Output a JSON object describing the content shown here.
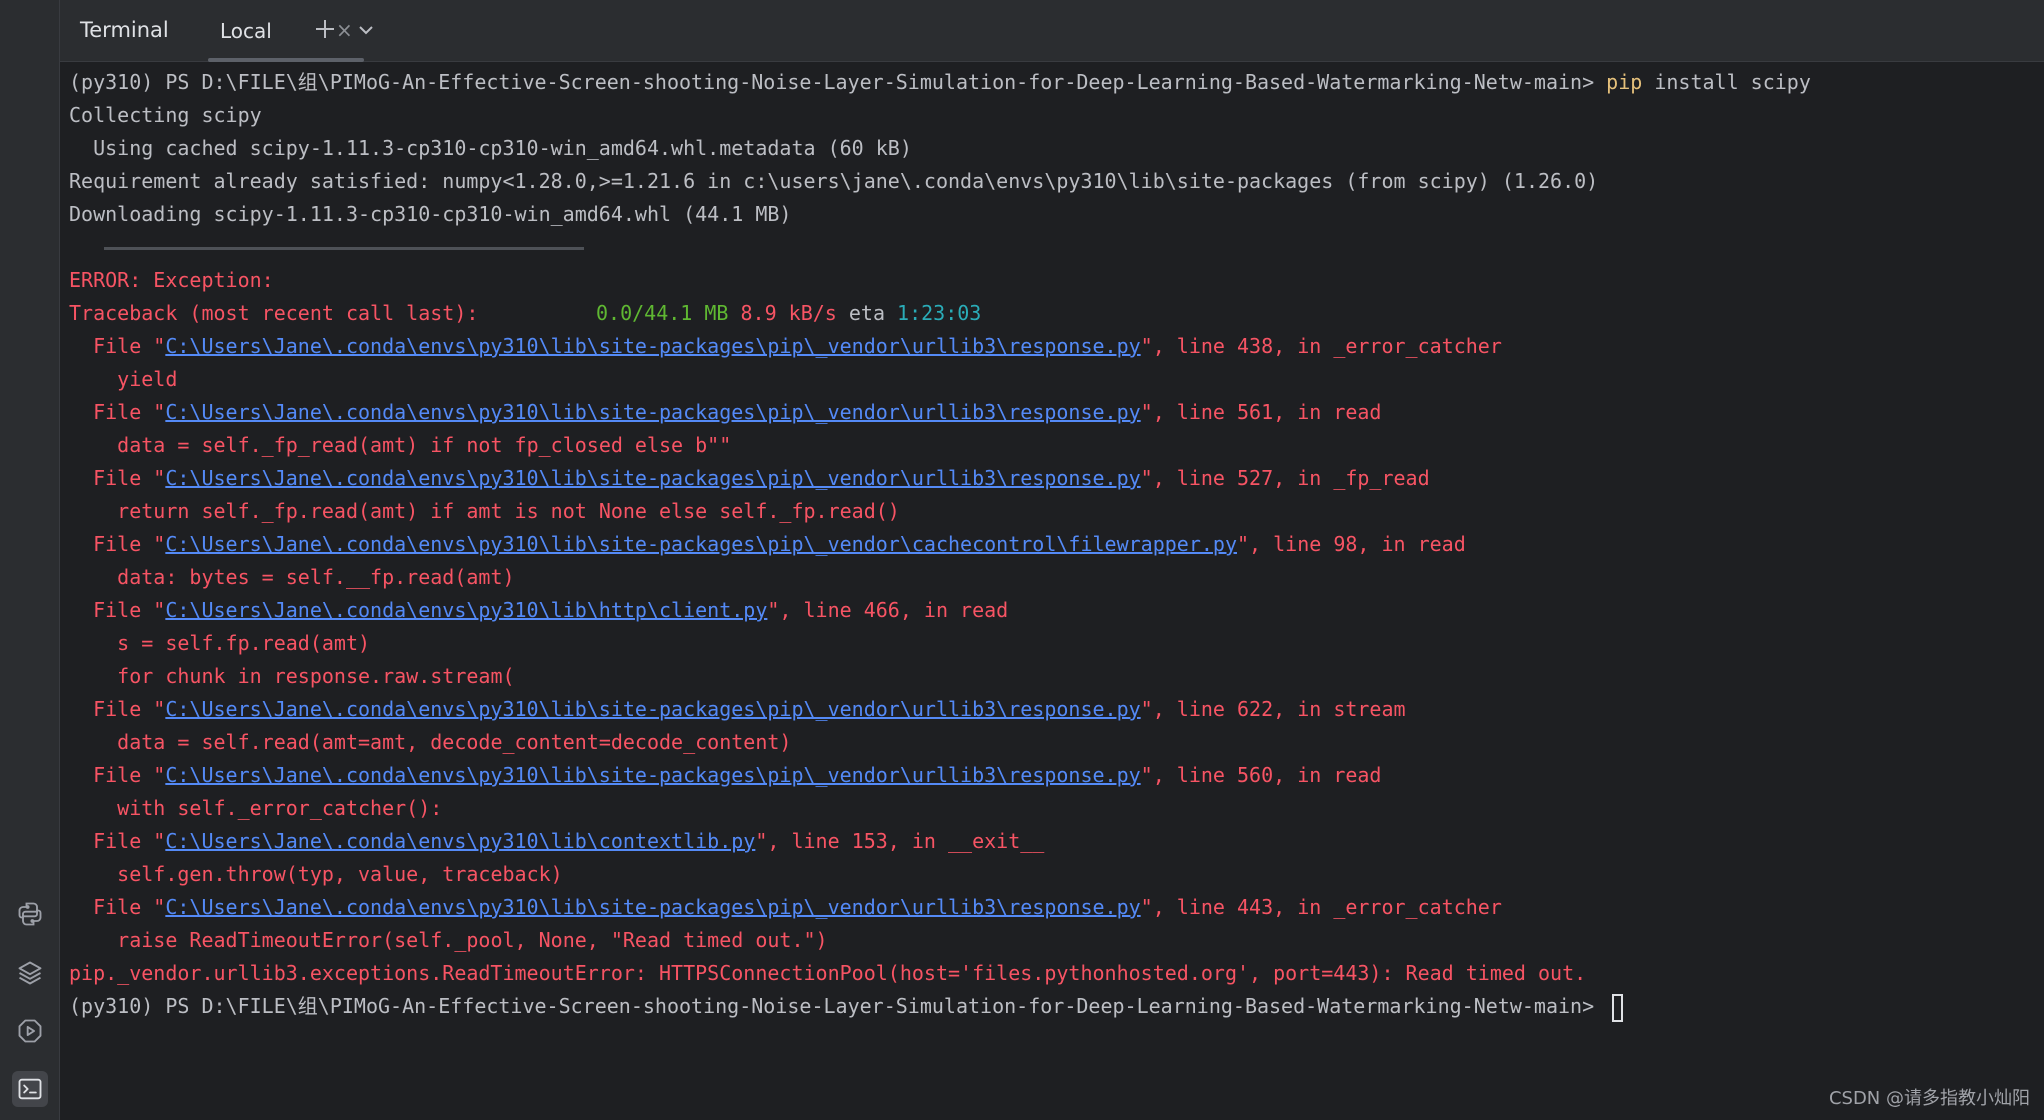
{
  "window": {
    "tool_title": "Terminal",
    "tab": {
      "label": "Local",
      "close_glyph": "×"
    }
  },
  "sidebar": {
    "icons": [
      "python-console-icon",
      "layers-icon",
      "run-services-icon",
      "terminal-icon"
    ]
  },
  "terminal": {
    "prompt1": {
      "prefix": "(py310) PS D:\\FILE\\组\\PIMoG-An-Effective-Screen-shooting-Noise-Layer-Simulation-for-Deep-Learning-Based-Watermarking-Netw-main> ",
      "cmd": "pip",
      "args": " install scipy"
    },
    "l_collecting": "Collecting scipy",
    "l_cached": "  Using cached scipy-1.11.3-cp310-cp310-win_amd64.whl.metadata (60 kB)",
    "l_requirement": "Requirement already satisfied: numpy<1.28.0,>=1.21.6 in c:\\users\\jane\\.conda\\envs\\py310\\lib\\site-packages (from scipy) (1.26.0)",
    "l_downloading": "Downloading scipy-1.11.3-cp310-cp310-win_amd64.whl (44.1 MB)",
    "progress": {
      "fraction": 0.0,
      "size": "0.0/44.1 MB",
      "speed": "8.9 kB/s",
      "eta_label": "eta",
      "eta": "1:23:03"
    },
    "l_error": "ERROR: Exception:",
    "l_traceback": "Traceback (most recent call last):",
    "frames": [
      {
        "path": "C:\\Users\\Jane\\.conda\\envs\\py310\\lib\\site-packages\\pip\\_vendor\\urllib3\\response.py",
        "where": "\", line 438, in _error_catcher",
        "code": [
          "yield"
        ]
      },
      {
        "path": "C:\\Users\\Jane\\.conda\\envs\\py310\\lib\\site-packages\\pip\\_vendor\\urllib3\\response.py",
        "where": "\", line 561, in read",
        "code": [
          "data = self._fp_read(amt) if not fp_closed else b\"\""
        ]
      },
      {
        "path": "C:\\Users\\Jane\\.conda\\envs\\py310\\lib\\site-packages\\pip\\_vendor\\urllib3\\response.py",
        "where": "\", line 527, in _fp_read",
        "code": [
          "return self._fp.read(amt) if amt is not None else self._fp.read()"
        ]
      },
      {
        "path": "C:\\Users\\Jane\\.conda\\envs\\py310\\lib\\site-packages\\pip\\_vendor\\cachecontrol\\filewrapper.py",
        "where": "\", line 98, in read",
        "code": [
          "data: bytes = self.__fp.read(amt)"
        ]
      },
      {
        "path": "C:\\Users\\Jane\\.conda\\envs\\py310\\lib\\http\\client.py",
        "where": "\", line 466, in read",
        "code": [
          "s = self.fp.read(amt)",
          "for chunk in response.raw.stream("
        ]
      },
      {
        "path": "C:\\Users\\Jane\\.conda\\envs\\py310\\lib\\site-packages\\pip\\_vendor\\urllib3\\response.py",
        "where": "\", line 622, in stream",
        "code": [
          "data = self.read(amt=amt, decode_content=decode_content)"
        ]
      },
      {
        "path": "C:\\Users\\Jane\\.conda\\envs\\py310\\lib\\site-packages\\pip\\_vendor\\urllib3\\response.py",
        "where": "\", line 560, in read",
        "code": [
          "with self._error_catcher():"
        ]
      },
      {
        "path": "C:\\Users\\Jane\\.conda\\envs\\py310\\lib\\contextlib.py",
        "where": "\", line 153, in __exit__",
        "code": [
          "self.gen.throw(typ, value, traceback)"
        ]
      },
      {
        "path": "C:\\Users\\Jane\\.conda\\envs\\py310\\lib\\site-packages\\pip\\_vendor\\urllib3\\response.py",
        "where": "\", line 443, in _error_catcher",
        "code": [
          "raise ReadTimeoutError(self._pool, None, \"Read timed out.\")"
        ]
      }
    ],
    "frame_file_prefix": "  File \"",
    "frame_code_indent": "    ",
    "l_exception": "pip._vendor.urllib3.exceptions.ReadTimeoutError: HTTPSConnectionPool(host='files.pythonhosted.org', port=443): Read timed out.",
    "prompt2": "(py310) PS D:\\FILE\\组\\PIMoG-An-Effective-Screen-shooting-Noise-Layer-Simulation-for-Deep-Learning-Based-Watermarking-Netw-main> "
  },
  "watermark": "CSDN @请多指教小灿阳",
  "colors": {
    "background": "#1e1f22",
    "panel": "#2b2d30",
    "text": "#bcbec4",
    "error": "#f75464",
    "link": "#548af7",
    "green": "#5fb832",
    "teal": "#2aacb8",
    "command": "#e5c07b"
  }
}
